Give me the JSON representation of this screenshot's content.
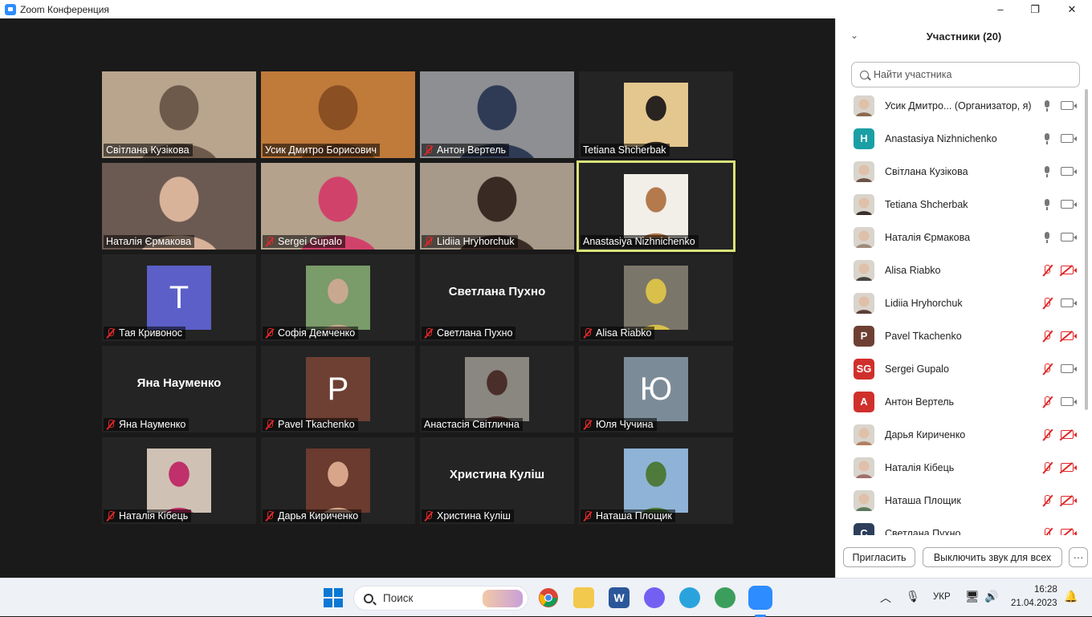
{
  "window": {
    "title": "Zoom Конференция",
    "minimize": "–",
    "maximize": "❐",
    "close": "✕"
  },
  "gallery": {
    "tiles": [
      {
        "name": "Світлана Кузікова",
        "muted": false,
        "kind": "video",
        "bg": "#b9a58e",
        "fg": "#6d5a4b"
      },
      {
        "name": "Усик Дмитро Борисович",
        "muted": false,
        "kind": "video",
        "bg": "#c07a3a",
        "fg": "#8a4f22"
      },
      {
        "name": "Антон Вертель",
        "muted": true,
        "kind": "video",
        "bg": "#8d8f93",
        "fg": "#2f3b55"
      },
      {
        "name": "Tetiana Shcherbak",
        "muted": false,
        "kind": "thumb",
        "bg": "#e4c78e",
        "fg": "#2a2420"
      },
      {
        "name": "Наталія Єрмакова",
        "muted": false,
        "kind": "video",
        "bg": "#6b5a52",
        "fg": "#d8b39a"
      },
      {
        "name": "Sergei Gupalo",
        "muted": true,
        "kind": "video",
        "bg": "#b5a28c",
        "fg": "#d1426a"
      },
      {
        "name": "Lidiia Hryhorchuk",
        "muted": true,
        "kind": "video",
        "bg": "#a89a8a",
        "fg": "#3a2a24"
      },
      {
        "name": "Anastasiya Nizhnichenko",
        "muted": false,
        "kind": "thumb",
        "bg": "#f2efe9",
        "fg": "#b47a4c",
        "active": true
      },
      {
        "name": "Тая Кривонос",
        "muted": true,
        "kind": "letter",
        "letter": "T",
        "bg": "#5b5fc7"
      },
      {
        "name": "Софія Демченко",
        "muted": true,
        "kind": "thumb",
        "bg": "#7a9b6a",
        "fg": "#c9a890"
      },
      {
        "name": "Светлана Пухно",
        "muted": true,
        "kind": "text",
        "big": "Светлана Пухно"
      },
      {
        "name": "Alisa Riabko",
        "muted": true,
        "kind": "thumb",
        "bg": "#7b766a",
        "fg": "#d8c04a"
      },
      {
        "name": "Яна Науменко",
        "muted": true,
        "kind": "text",
        "big": "Яна Науменко"
      },
      {
        "name": "Pavel Tkachenko",
        "muted": true,
        "kind": "letter",
        "letter": "P",
        "bg": "#6e4033"
      },
      {
        "name": "Анастасія Світлична",
        "muted": false,
        "kind": "thumb",
        "bg": "#8a8680",
        "fg": "#4a2e2a"
      },
      {
        "name": "Юля Чучина",
        "muted": true,
        "kind": "letter",
        "letter": "Ю",
        "bg": "#7b8c98"
      },
      {
        "name": "Наталія Кібець",
        "muted": true,
        "kind": "thumb",
        "bg": "#cfc2b4",
        "fg": "#c0306a"
      },
      {
        "name": "Дарья Кириченко",
        "muted": true,
        "kind": "thumb",
        "bg": "#6a3b2e",
        "fg": "#d9a58a"
      },
      {
        "name": "Христина Куліш",
        "muted": true,
        "kind": "text",
        "big": "Христина Куліш"
      },
      {
        "name": "Наташа Площик",
        "muted": true,
        "kind": "thumb",
        "bg": "#8fb3d6",
        "fg": "#4e7a3c"
      }
    ]
  },
  "participants": {
    "title": "Участники (20)",
    "search_placeholder": "Найти участника",
    "list": [
      {
        "name": "Усик Дмитро...  (Организатор, я)",
        "avatar": "",
        "color": "#8a6a50",
        "photo": true,
        "mic": "on",
        "cam": "on"
      },
      {
        "name": "Anastasiya Nizhnichenko",
        "avatar": "H",
        "color": "#1aa0a4",
        "photo": false,
        "mic": "on",
        "cam": "on"
      },
      {
        "name": "Світлана Кузікова",
        "avatar": "",
        "color": "#6b5446",
        "photo": true,
        "mic": "on",
        "cam": "on"
      },
      {
        "name": "Tetiana Shcherbak",
        "avatar": "",
        "color": "#3a2f2a",
        "photo": true,
        "mic": "on",
        "cam": "on"
      },
      {
        "name": "Наталія Єрмакова",
        "avatar": "",
        "color": "#a08a7a",
        "photo": true,
        "mic": "on",
        "cam": "on"
      },
      {
        "name": "Alisa Riabko",
        "avatar": "",
        "color": "#4a4540",
        "photo": true,
        "mic": "off",
        "cam": "off"
      },
      {
        "name": "Lidiia Hryhorchuk",
        "avatar": "",
        "color": "#5a4038",
        "photo": true,
        "mic": "off",
        "cam": "on"
      },
      {
        "name": "Pavel Tkachenko",
        "avatar": "P",
        "color": "#6e4033",
        "photo": false,
        "mic": "off",
        "cam": "off"
      },
      {
        "name": "Sergei Gupalo",
        "avatar": "SG",
        "color": "#d0302c",
        "photo": false,
        "mic": "off",
        "cam": "on"
      },
      {
        "name": "Антон Вертель",
        "avatar": "A",
        "color": "#d0302c",
        "photo": false,
        "mic": "off",
        "cam": "on"
      },
      {
        "name": "Дарья Кириченко",
        "avatar": "",
        "color": "#b08060",
        "photo": true,
        "mic": "off",
        "cam": "off"
      },
      {
        "name": "Наталія Кібець",
        "avatar": "",
        "color": "#a0706a",
        "photo": true,
        "mic": "off",
        "cam": "off"
      },
      {
        "name": "Наташа Площик",
        "avatar": "",
        "color": "#5a7a5a",
        "photo": true,
        "mic": "off",
        "cam": "off"
      },
      {
        "name": "Светлана Пухно",
        "avatar": "C",
        "color": "#2c3e5a",
        "photo": false,
        "mic": "off",
        "cam": "off"
      }
    ],
    "invite_label": "Пригласить",
    "mute_all_label": "Выключить звук для всех",
    "more_label": "···"
  },
  "taskbar": {
    "search_label": "Поиск",
    "lang": "УКР",
    "time": "16:28",
    "date": "21.04.2023"
  }
}
